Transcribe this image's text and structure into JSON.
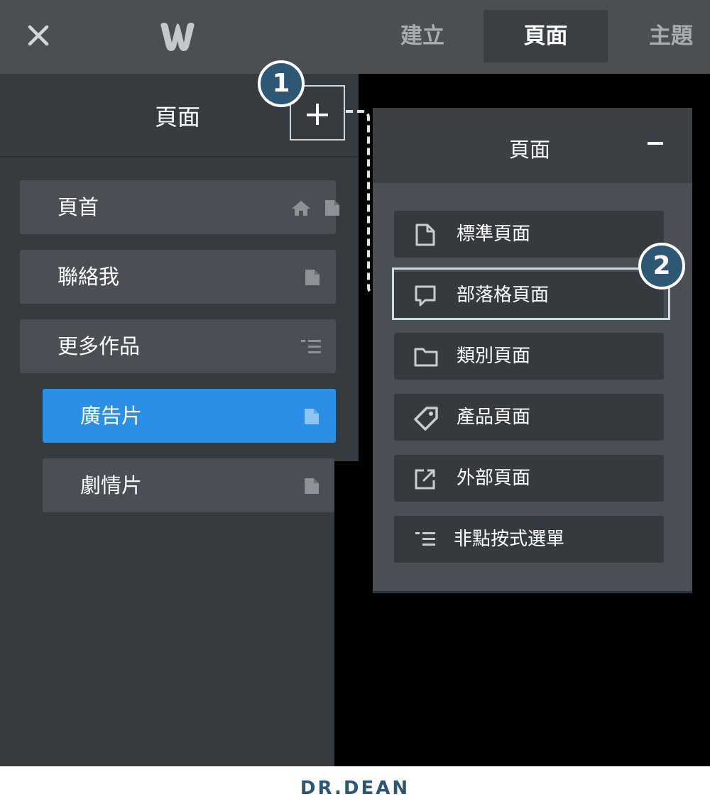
{
  "topbar": {
    "tabs": [
      {
        "label": "建立"
      },
      {
        "label": "頁面"
      },
      {
        "label": "主題"
      }
    ]
  },
  "left_panel": {
    "title": "頁面",
    "pages": [
      {
        "label": "頁首"
      },
      {
        "label": "聯絡我"
      },
      {
        "label": "更多作品"
      },
      {
        "label": "廣告片"
      },
      {
        "label": "劇情片"
      }
    ]
  },
  "right_panel": {
    "title": "頁面",
    "types": [
      {
        "label": "標準頁面",
        "icon": "page-icon"
      },
      {
        "label": "部落格頁面",
        "icon": "comment-icon"
      },
      {
        "label": "類別頁面",
        "icon": "folder-icon"
      },
      {
        "label": "產品頁面",
        "icon": "tag-icon"
      },
      {
        "label": "外部頁面",
        "icon": "external-link-icon"
      },
      {
        "label": "非點按式選單",
        "icon": "menu-list-icon"
      }
    ]
  },
  "annotations": {
    "step1": "1",
    "step2": "2"
  },
  "footer": {
    "brand": "DR.DEAN"
  },
  "colors": {
    "topbar": "#4a4f54",
    "panel": "#363b40",
    "item": "#4a4f55",
    "active": "#2b8fe6",
    "badge": "#2e5675"
  }
}
